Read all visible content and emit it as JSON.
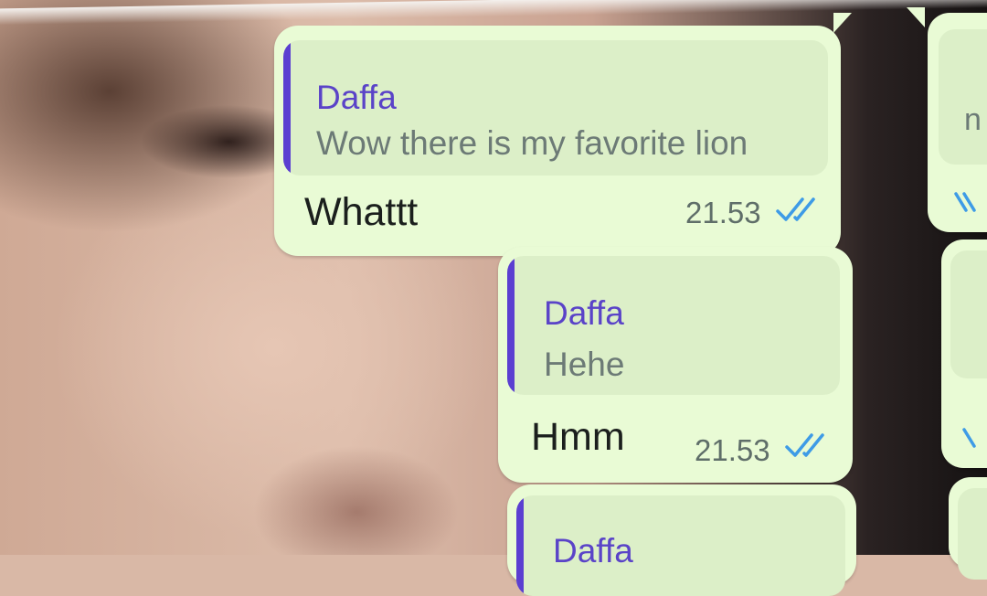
{
  "messages": [
    {
      "quote_author": "Daffa",
      "quote_text": "Wow there is my favorite lion",
      "text": "Whattt",
      "time": "21.53",
      "status_icon": "double-check-icon"
    },
    {
      "quote_author": "Daffa",
      "quote_text": "Hehe",
      "text": "Hmm",
      "time": "21.53",
      "status_icon": "double-check-icon"
    },
    {
      "quote_author": "Daffa"
    }
  ],
  "side_fragment": "n",
  "colors": {
    "bubble": "#e9fbd5",
    "quote_bg": "#dcefc8",
    "quote_bar": "#5b3fd1",
    "author": "#5a43c8",
    "tick": "#3e9be6"
  }
}
